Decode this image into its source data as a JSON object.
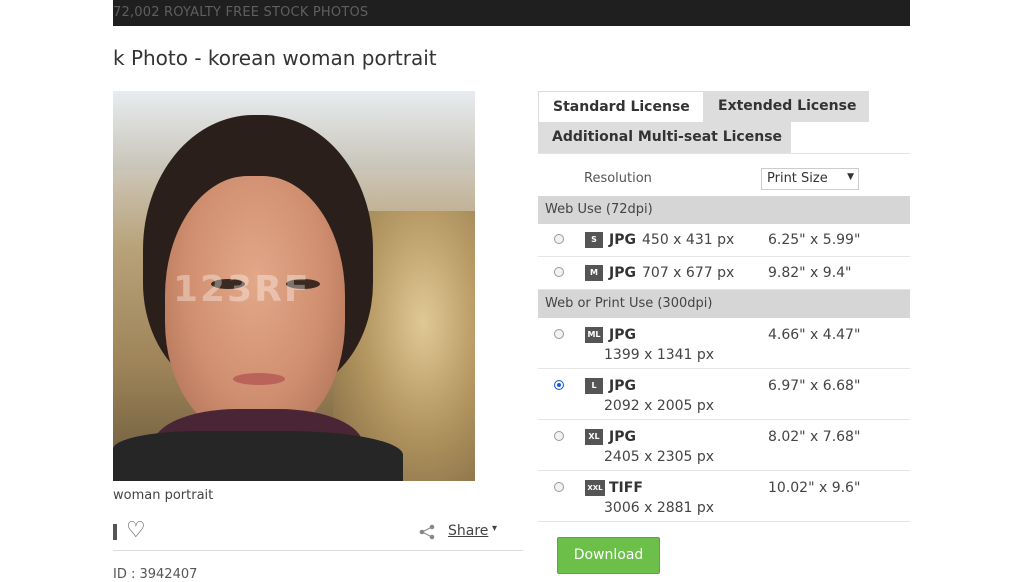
{
  "topbar": {
    "text": "72,002  ROYALTY FREE STOCK PHOTOS"
  },
  "page_title": "k Photo - korean woman portrait",
  "photo": {
    "watermark": "123RF"
  },
  "caption": "woman portrait",
  "actions": {
    "share_label": "Share",
    "share_caret": "▾",
    "heart_icon": "♡"
  },
  "id_line": "ID : 3942407",
  "tabs": [
    {
      "label": "Standard License",
      "active": true
    },
    {
      "label": "Extended License",
      "active": false
    },
    {
      "label": "Additional Multi-seat License",
      "active": false
    }
  ],
  "resolution": {
    "label": "Resolution",
    "selected": "Print Size",
    "caret": "▼"
  },
  "sections": [
    {
      "title": "Web Use (72dpi)"
    },
    {
      "title": "Web or Print Use (300dpi)"
    }
  ],
  "rows": [
    {
      "badge": "S",
      "format": "JPG",
      "pixels": "450 x 431 px",
      "inches": "6.25\" x 5.99\"",
      "selected": false
    },
    {
      "badge": "M",
      "format": "JPG",
      "pixels": "707 x 677 px",
      "inches": "9.82\" x 9.4\"",
      "selected": false
    },
    {
      "badge": "ML",
      "format": "JPG",
      "pixels": "1399 x 1341 px",
      "inches": "4.66\" x 4.47\"",
      "selected": false
    },
    {
      "badge": "L",
      "format": "JPG",
      "pixels": "2092 x 2005 px",
      "inches": "6.97\" x 6.68\"",
      "selected": true
    },
    {
      "badge": "XL",
      "format": "JPG",
      "pixels": "2405 x 2305 px",
      "inches": "8.02\" x 7.68\"",
      "selected": false
    },
    {
      "badge": "XXL",
      "format": "TIFF",
      "pixels": "3006 x 2881 px",
      "inches": "10.02\" x 9.6\"",
      "selected": false
    }
  ],
  "download": {
    "label": "Download"
  },
  "colors": {
    "download_bg": "#6cc04a",
    "section_bg": "#d6d6d6",
    "tab_inactive": "#dddddd"
  }
}
